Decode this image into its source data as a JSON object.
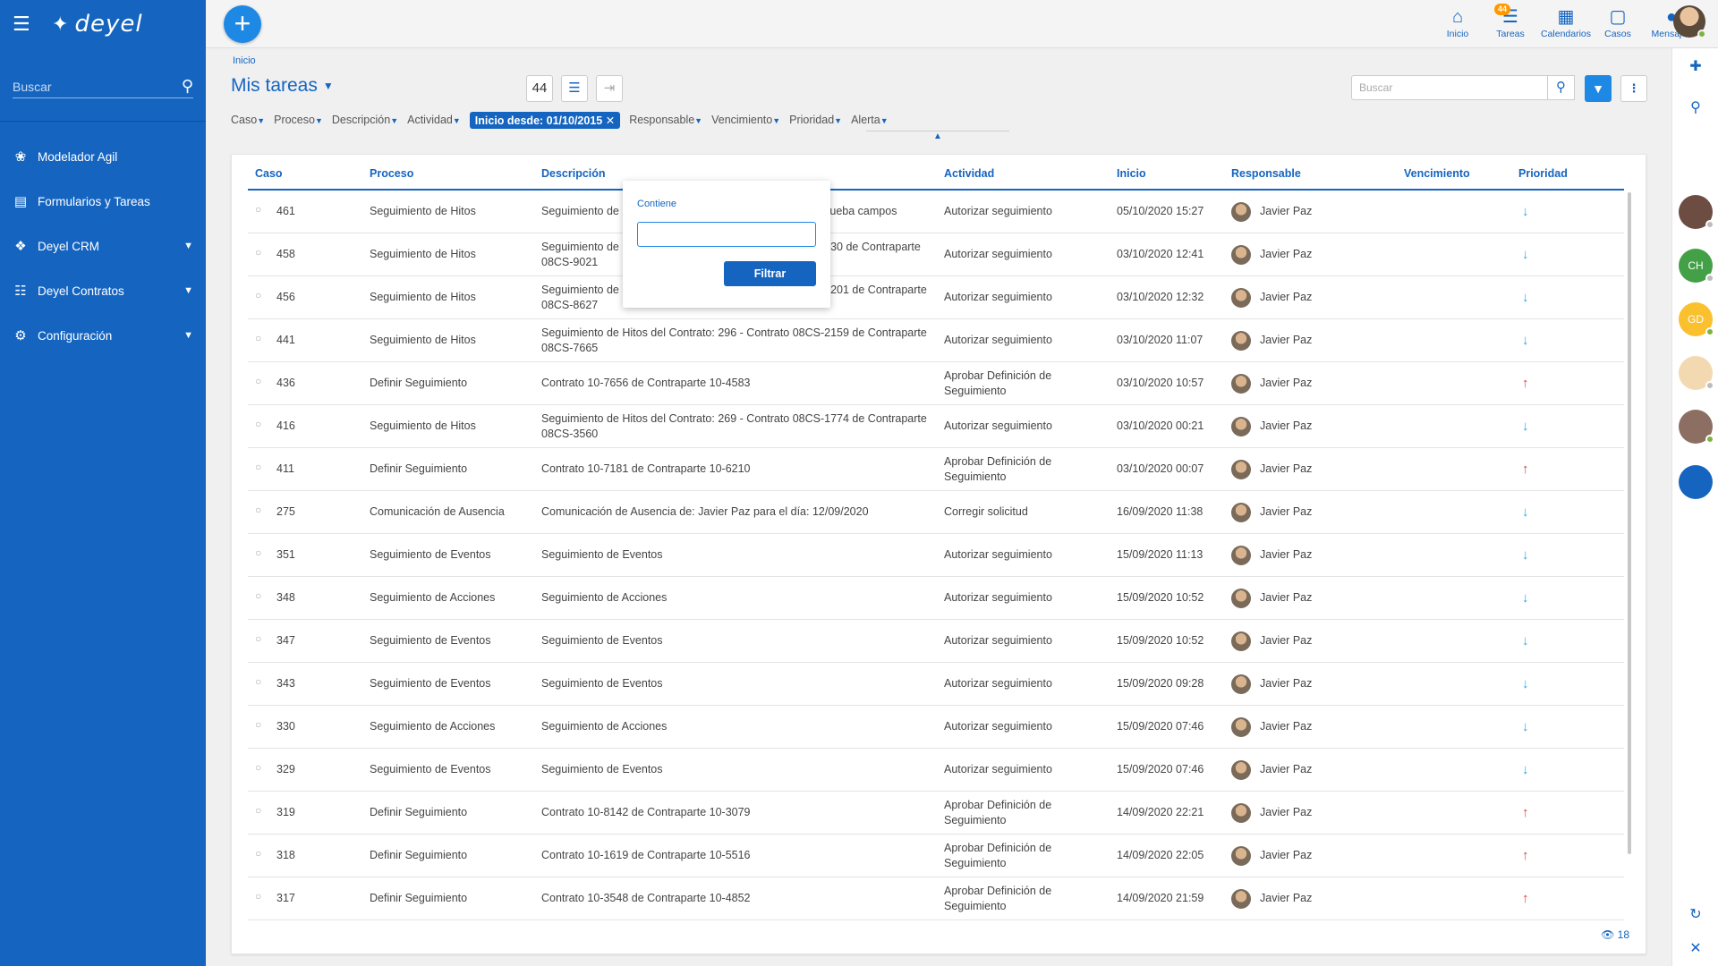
{
  "sidebar": {
    "logo": "deyel",
    "search_placeholder": "Buscar",
    "items": [
      {
        "label": "Modelador Agil",
        "icon": "brain-icon"
      },
      {
        "label": "Formularios y Tareas",
        "icon": "form-icon"
      },
      {
        "label": "Deyel CRM",
        "icon": "puzzle-icon",
        "expandable": true
      },
      {
        "label": "Deyel Contratos",
        "icon": "document-icon",
        "expandable": true
      },
      {
        "label": "Configuración",
        "icon": "gear-icon",
        "expandable": true
      }
    ]
  },
  "topbar": {
    "nav": [
      {
        "label": "Inicio",
        "icon": "home-icon"
      },
      {
        "label": "Tareas",
        "icon": "tasks-icon",
        "badge": "44"
      },
      {
        "label": "Calendarios",
        "icon": "calendar-icon"
      },
      {
        "label": "Casos",
        "icon": "square-icon"
      },
      {
        "label": "Mensajes",
        "icon": "chat-icon"
      }
    ]
  },
  "main": {
    "breadcrumb": "Inicio",
    "title": "Mis tareas",
    "count": "44",
    "search_placeholder": "Buscar",
    "filters": [
      "Caso",
      "Proceso",
      "Descripción",
      "Actividad"
    ],
    "active_filter": "Inicio desde: 01/10/2015",
    "filters_after": [
      "Responsable",
      "Vencimiento",
      "Prioridad",
      "Alerta"
    ],
    "popup": {
      "label": "Contiene",
      "input_value": "",
      "button": "Filtrar"
    },
    "columns": [
      "Caso",
      "Proceso",
      "Descripción",
      "Actividad",
      "Inicio",
      "Responsable",
      "Vencimiento",
      "Prioridad"
    ],
    "rows": [
      {
        "caso": "461",
        "proceso": "Seguimiento de Hitos",
        "descripcion": "Seguimiento de Hitos del Contrato: 312 - campo hito de prueba campos",
        "actividad": "Autorizar seguimiento",
        "inicio": "05/10/2020 15:27",
        "responsable": "Javier Paz",
        "prioridad": "low"
      },
      {
        "caso": "458",
        "proceso": "Seguimiento de Hitos",
        "descripcion": "Seguimiento de Hitos del Contrato: 309 - Contrato 08CS-530 de Contraparte 08CS-9021",
        "actividad": "Autorizar seguimiento",
        "inicio": "03/10/2020 12:41",
        "responsable": "Javier Paz",
        "prioridad": "low"
      },
      {
        "caso": "456",
        "proceso": "Seguimiento de Hitos",
        "descripcion": "Seguimiento de Hitos del Contrato: 308 - Contrato 08CS-3201 de Contraparte 08CS-8627",
        "actividad": "Autorizar seguimiento",
        "inicio": "03/10/2020 12:32",
        "responsable": "Javier Paz",
        "prioridad": "low"
      },
      {
        "caso": "441",
        "proceso": "Seguimiento de Hitos",
        "descripcion": "Seguimiento de Hitos del Contrato: 296 - Contrato 08CS-2159 de Contraparte 08CS-7665",
        "actividad": "Autorizar seguimiento",
        "inicio": "03/10/2020 11:07",
        "responsable": "Javier Paz",
        "prioridad": "low"
      },
      {
        "caso": "436",
        "proceso": "Definir Seguimiento",
        "descripcion": "Contrato 10-7656 de Contraparte 10-4583",
        "actividad": "Aprobar Definición de Seguimiento",
        "inicio": "03/10/2020 10:57",
        "responsable": "Javier Paz",
        "prioridad": "high"
      },
      {
        "caso": "416",
        "proceso": "Seguimiento de Hitos",
        "descripcion": "Seguimiento de Hitos del Contrato: 269 - Contrato 08CS-1774 de Contraparte 08CS-3560",
        "actividad": "Autorizar seguimiento",
        "inicio": "03/10/2020 00:21",
        "responsable": "Javier Paz",
        "prioridad": "low"
      },
      {
        "caso": "411",
        "proceso": "Definir Seguimiento",
        "descripcion": "Contrato 10-7181 de Contraparte 10-6210",
        "actividad": "Aprobar Definición de Seguimiento",
        "inicio": "03/10/2020 00:07",
        "responsable": "Javier Paz",
        "prioridad": "high"
      },
      {
        "caso": "275",
        "proceso": "Comunicación de Ausencia",
        "descripcion": "Comunicación de Ausencia de: Javier Paz para el día: 12/09/2020",
        "actividad": "Corregir solicitud",
        "inicio": "16/09/2020 11:38",
        "responsable": "Javier Paz",
        "prioridad": "low"
      },
      {
        "caso": "351",
        "proceso": "Seguimiento de Eventos",
        "descripcion": "Seguimiento de Eventos",
        "actividad": "Autorizar seguimiento",
        "inicio": "15/09/2020 11:13",
        "responsable": "Javier Paz",
        "prioridad": "low"
      },
      {
        "caso": "348",
        "proceso": "Seguimiento de Acciones",
        "descripcion": "Seguimiento de Acciones",
        "actividad": "Autorizar seguimiento",
        "inicio": "15/09/2020 10:52",
        "responsable": "Javier Paz",
        "prioridad": "low"
      },
      {
        "caso": "347",
        "proceso": "Seguimiento de Eventos",
        "descripcion": "Seguimiento de Eventos",
        "actividad": "Autorizar seguimiento",
        "inicio": "15/09/2020 10:52",
        "responsable": "Javier Paz",
        "prioridad": "low"
      },
      {
        "caso": "343",
        "proceso": "Seguimiento de Eventos",
        "descripcion": "Seguimiento de Eventos",
        "actividad": "Autorizar seguimiento",
        "inicio": "15/09/2020 09:28",
        "responsable": "Javier Paz",
        "prioridad": "low"
      },
      {
        "caso": "330",
        "proceso": "Seguimiento de Acciones",
        "descripcion": "Seguimiento de Acciones",
        "actividad": "Autorizar seguimiento",
        "inicio": "15/09/2020 07:46",
        "responsable": "Javier Paz",
        "prioridad": "low"
      },
      {
        "caso": "329",
        "proceso": "Seguimiento de Eventos",
        "descripcion": "Seguimiento de Eventos",
        "actividad": "Autorizar seguimiento",
        "inicio": "15/09/2020 07:46",
        "responsable": "Javier Paz",
        "prioridad": "low"
      },
      {
        "caso": "319",
        "proceso": "Definir Seguimiento",
        "descripcion": "Contrato 10-8142 de Contraparte 10-3079",
        "actividad": "Aprobar Definición de Seguimiento",
        "inicio": "14/09/2020 22:21",
        "responsable": "Javier Paz",
        "prioridad": "high"
      },
      {
        "caso": "318",
        "proceso": "Definir Seguimiento",
        "descripcion": "Contrato 10-1619 de Contraparte 10-5516",
        "actividad": "Aprobar Definición de Seguimiento",
        "inicio": "14/09/2020 22:05",
        "responsable": "Javier Paz",
        "prioridad": "high"
      },
      {
        "caso": "317",
        "proceso": "Definir Seguimiento",
        "descripcion": "Contrato 10-3548 de Contraparte 10-4852",
        "actividad": "Aprobar Definición de Seguimiento",
        "inicio": "14/09/2020 21:59",
        "responsable": "Javier Paz",
        "prioridad": "high"
      }
    ],
    "views_count": "18"
  },
  "rail": {
    "contacts": [
      {
        "initials": "",
        "color": "#6d4c41",
        "status": "#bdbdbd"
      },
      {
        "initials": "CH",
        "color": "#43a047",
        "status": "#bdbdbd"
      },
      {
        "initials": "GD",
        "color": "#fbc02d",
        "status": "#7cb342"
      },
      {
        "initials": "",
        "color": "#f3d9b1",
        "status": "#bdbdbd"
      },
      {
        "initials": "",
        "color": "#8d6e63",
        "status": "#7cb342"
      },
      {
        "initials": "",
        "color": "#1565c0",
        "status": ""
      }
    ]
  },
  "colors": {
    "primary": "#1565c0",
    "accent": "#1e88e5",
    "badge": "#ff9800",
    "prio_low": "#29a8e0",
    "prio_high": "#e53935"
  }
}
